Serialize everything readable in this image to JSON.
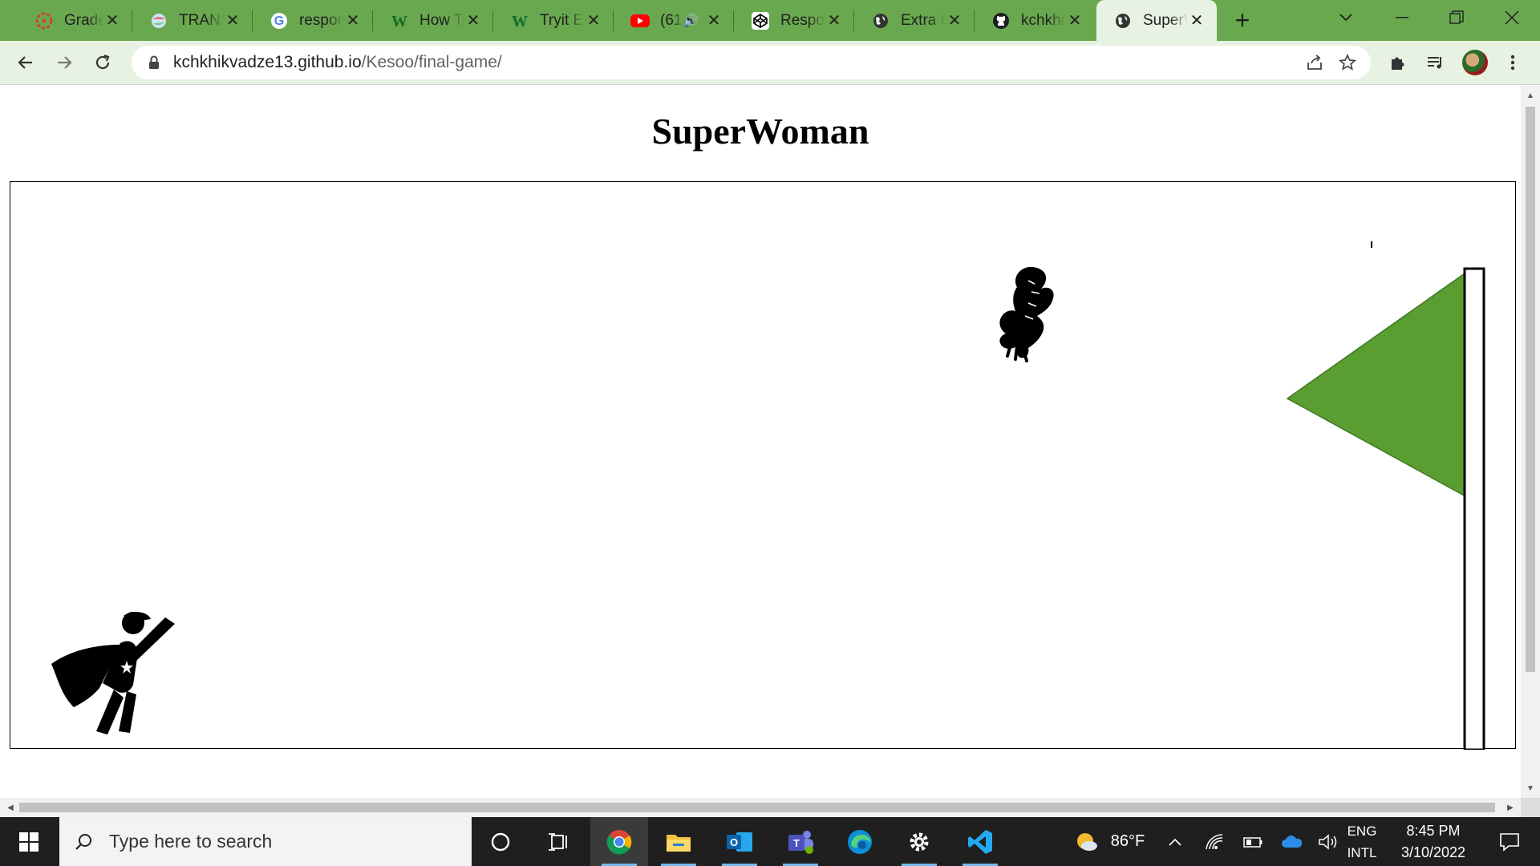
{
  "browser": {
    "tabs": [
      {
        "title": "Grades",
        "icon": "canvas-icon"
      },
      {
        "title": "TRANSL",
        "icon": "globe-colorful-icon"
      },
      {
        "title": "respon",
        "icon": "google-icon"
      },
      {
        "title": "How To",
        "icon": "w-logo-icon"
      },
      {
        "title": "Tryit Ed",
        "icon": "w-logo-icon"
      },
      {
        "title": "(61",
        "icon": "youtube-icon"
      },
      {
        "title": "Respon",
        "icon": "codepen-icon"
      },
      {
        "title": "Extra C",
        "icon": "globe-icon"
      },
      {
        "title": "kchkhi",
        "icon": "github-icon"
      },
      {
        "title": "SuperW",
        "icon": "globe-icon",
        "active": true
      }
    ],
    "address": {
      "domain": "kchkhikvadze13.github.io",
      "path": "/Kesoo/final-game/"
    },
    "colors": {
      "frame": "#6aa84f",
      "toolbar": "#e8f2e3"
    }
  },
  "page": {
    "title": "SuperWoman",
    "game": {
      "player": "superwoman-icon",
      "enemy": "eagle-icon",
      "goal": "flag-icon",
      "flag_color": "#5a9e32"
    }
  },
  "taskbar": {
    "search_placeholder": "Type here to search",
    "weather": "86°F",
    "lang_top": "ENG",
    "lang_bottom": "INTL",
    "time": "8:45 PM",
    "date": "3/10/2022"
  }
}
